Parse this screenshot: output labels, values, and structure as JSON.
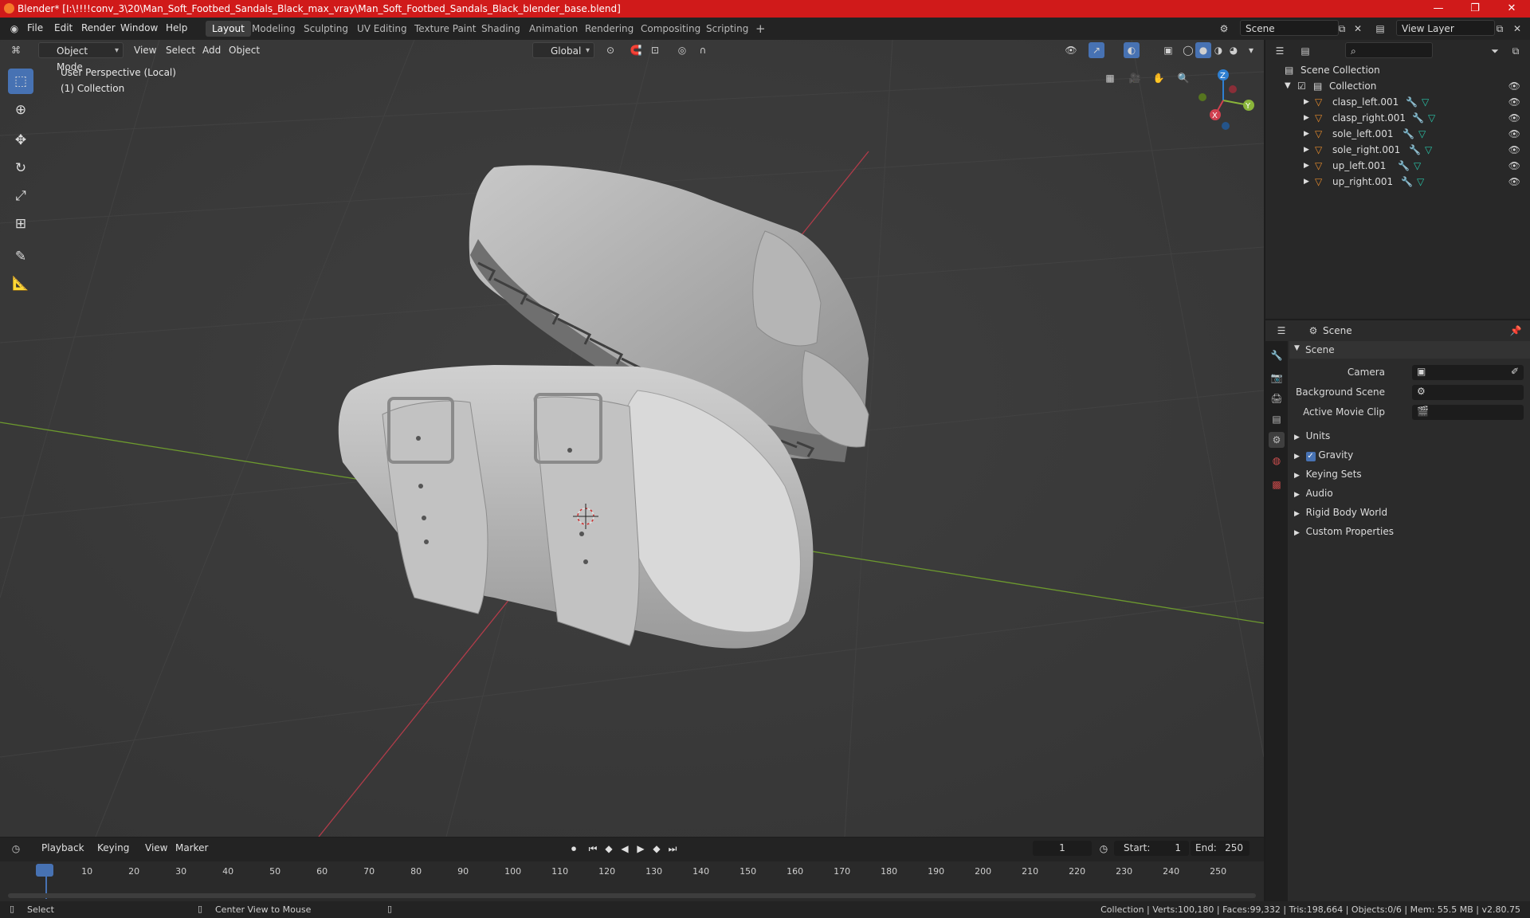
{
  "window": {
    "title": "Blender* [I:\\!!!!conv_3\\20\\Man_Soft_Footbed_Sandals_Black_max_vray\\Man_Soft_Footbed_Sandals_Black_blender_base.blend]",
    "minimize": "—",
    "maximize": "❐",
    "close": "✕"
  },
  "menu": [
    "File",
    "Edit",
    "Render",
    "Window",
    "Help"
  ],
  "workspaces": [
    "Layout",
    "Modeling",
    "Sculpting",
    "UV Editing",
    "Texture Paint",
    "Shading",
    "Animation",
    "Rendering",
    "Compositing",
    "Scripting"
  ],
  "active_workspace": "Layout",
  "scene_field": "Scene",
  "view_layer_field": "View Layer",
  "viewport": {
    "mode": "Object Mode",
    "menus": [
      "View",
      "Select",
      "Add",
      "Object"
    ],
    "transform_orientation": "Global",
    "overlay_title": "User Perspective (Local)",
    "overlay_collection": "(1) Collection",
    "gizmo_axes": {
      "x": "X",
      "y": "Y",
      "z": "Z"
    }
  },
  "outliner": {
    "root": "Scene Collection",
    "collection": "Collection",
    "objects": [
      "clasp_left.001",
      "clasp_right.001",
      "sole_left.001",
      "sole_right.001",
      "up_left.001",
      "up_right.001"
    ]
  },
  "properties": {
    "header": "Scene",
    "panel": "Scene",
    "fields": [
      {
        "label": "Camera"
      },
      {
        "label": "Background Scene"
      },
      {
        "label": "Active Movie Clip"
      }
    ],
    "sections": [
      "Units",
      "Gravity",
      "Keying Sets",
      "Audio",
      "Rigid Body World",
      "Custom Properties"
    ],
    "gravity_checked": true
  },
  "timeline": {
    "menus": [
      "Playback",
      "Keying",
      "View",
      "Marker"
    ],
    "current_frame": "1",
    "start_label": "Start:",
    "start": "1",
    "end_label": "End:",
    "end": "250",
    "ticks": [
      "1",
      "10",
      "20",
      "30",
      "40",
      "50",
      "60",
      "70",
      "80",
      "90",
      "100",
      "110",
      "120",
      "130",
      "140",
      "150",
      "160",
      "170",
      "180",
      "190",
      "200",
      "210",
      "220",
      "230",
      "240",
      "250"
    ]
  },
  "statusbar": {
    "left": "Select",
    "middle": "Center View to Mouse",
    "right": "Collection | Verts:100,180 | Faces:99,332 | Tris:198,664 | Objects:0/6 | Mem: 55.5 MB | v2.80.75"
  },
  "colors": {
    "accent": "#4772b3",
    "titlebar": "#d01a1a",
    "x_axis": "#d0404f",
    "y_axis": "#8ab53a",
    "z_axis": "#2e7fd1",
    "object_icon": "#e78c2d",
    "mesh_icon": "#29c4a8"
  }
}
